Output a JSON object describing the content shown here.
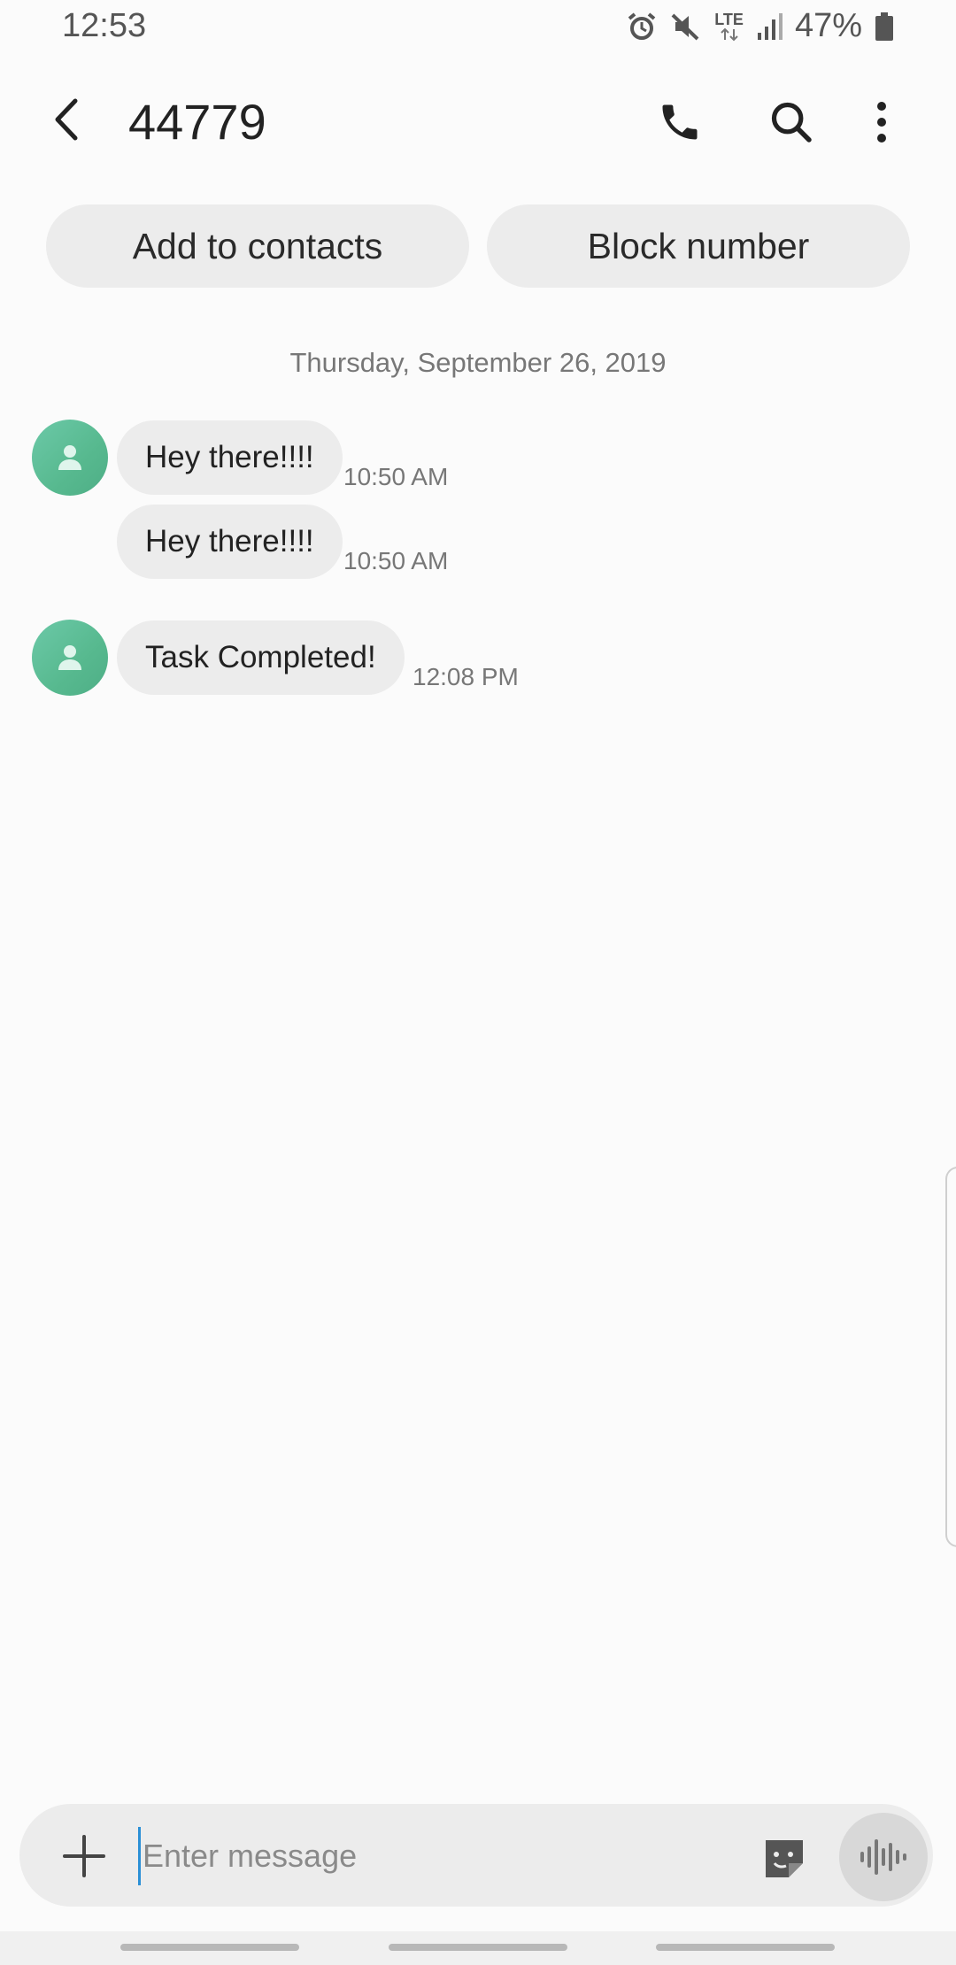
{
  "status_bar": {
    "time": "12:53",
    "network": "LTE",
    "battery": "47%",
    "icons": [
      "alarm-icon",
      "mute-icon",
      "lte-icon",
      "signal-icon",
      "battery-icon"
    ]
  },
  "header": {
    "title": "44779",
    "icons": [
      "back-icon",
      "phone-icon",
      "search-icon",
      "more-vert-icon"
    ]
  },
  "actions": {
    "add_contact": "Add to contacts",
    "block": "Block number"
  },
  "conversation": {
    "date": "Thursday, September 26, 2019",
    "messages": [
      {
        "text": "Hey there!!!!",
        "time": "10:50 AM"
      },
      {
        "text": "Hey there!!!!",
        "time": "10:50 AM"
      },
      {
        "text": "Task Completed!",
        "time": "12:08 PM"
      }
    ]
  },
  "composer": {
    "placeholder": "Enter message",
    "icons": [
      "plus-icon",
      "sticker-icon",
      "voice-icon"
    ]
  },
  "colors": {
    "background": "#fbfbfb",
    "bubble": "#ececec",
    "avatar": "#5cbf96",
    "cursor": "#2a8fd6"
  }
}
